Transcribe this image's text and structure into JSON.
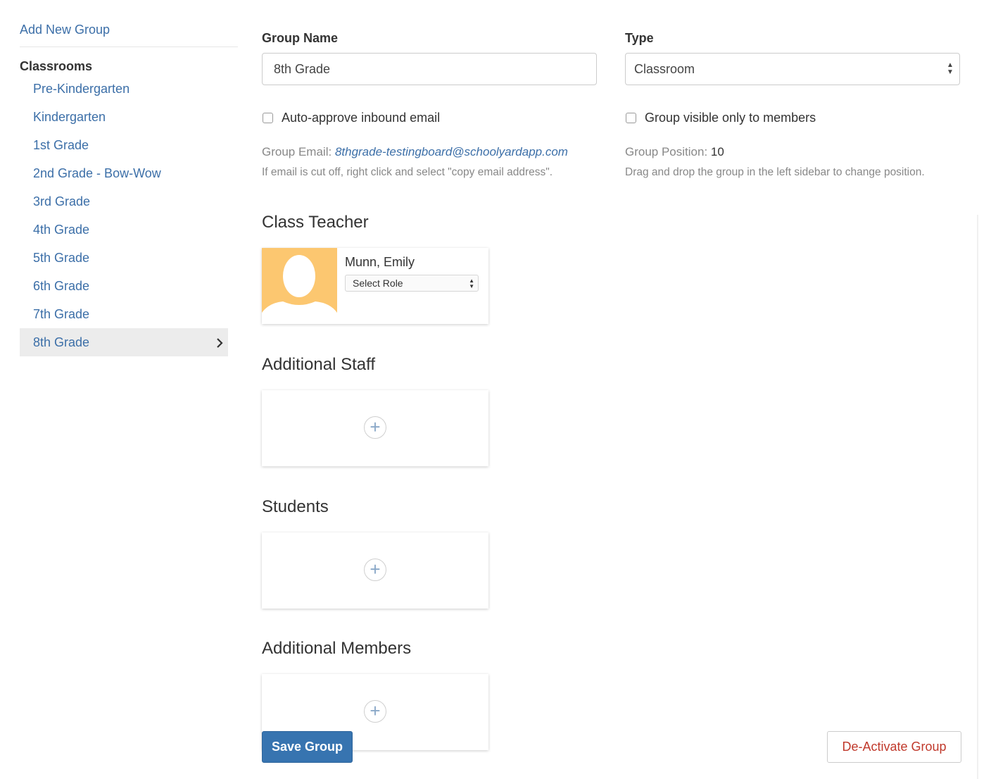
{
  "sidebar": {
    "add_label": "Add New Group",
    "section_title": "Classrooms",
    "items": [
      {
        "label": "Pre-Kindergarten"
      },
      {
        "label": "Kindergarten"
      },
      {
        "label": "1st Grade"
      },
      {
        "label": "2nd Grade - Bow-Wow"
      },
      {
        "label": "3rd Grade"
      },
      {
        "label": "4th Grade"
      },
      {
        "label": "5th Grade"
      },
      {
        "label": "6th Grade"
      },
      {
        "label": "7th Grade"
      },
      {
        "label": "8th Grade"
      }
    ],
    "active_index": 9
  },
  "form": {
    "group_name_label": "Group Name",
    "group_name_value": "8th Grade",
    "type_label": "Type",
    "type_value": "Classroom",
    "auto_approve_label": "Auto-approve inbound email",
    "visible_label": "Group visible only to members",
    "group_email_label": "Group Email: ",
    "group_email_value": "8thgrade-testingboard@schoolyardapp.com",
    "email_hint": "If email is cut off, right click and select \"copy email address\".",
    "group_position_label": "Group Position: ",
    "group_position_value": "10",
    "position_hint": "Drag and drop the group in the left sidebar to change position."
  },
  "sections": {
    "class_teacher": "Class Teacher",
    "additional_staff": "Additional Staff",
    "students": "Students",
    "additional_members": "Additional Members"
  },
  "teacher": {
    "name": "Munn, Emily",
    "role_placeholder": "Select Role"
  },
  "buttons": {
    "save": "Save Group",
    "deactivate": "De-Activate Group"
  },
  "colors": {
    "link": "#3c6fa8",
    "primary": "#3774b0",
    "danger": "#c0392b",
    "avatar_bg": "#fcc770"
  }
}
